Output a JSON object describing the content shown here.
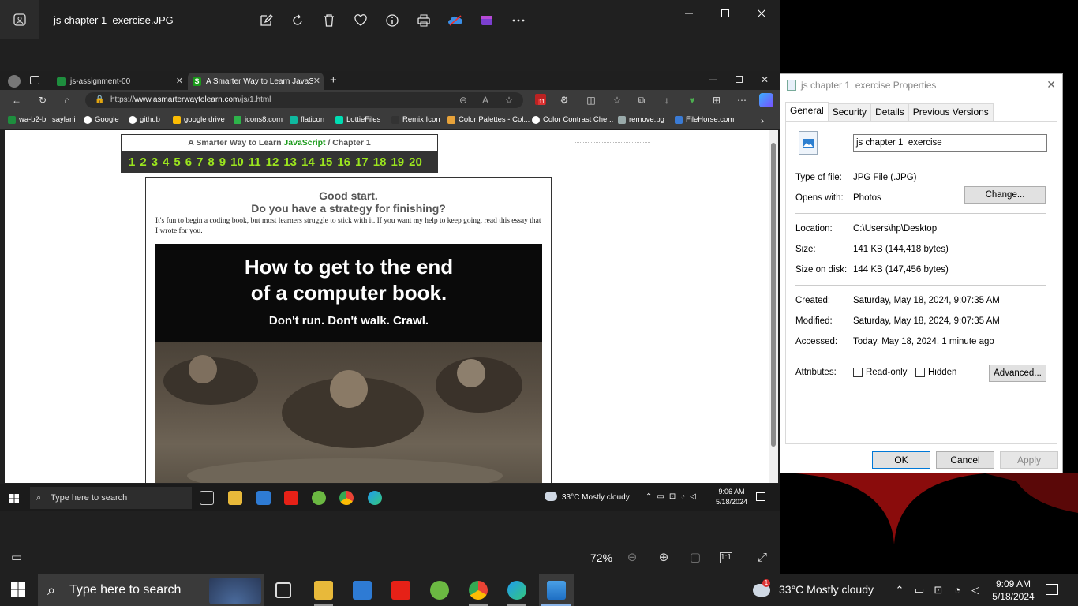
{
  "photos": {
    "title": "js chapter 1  exercise.JPG",
    "toolbar_icons": [
      "edit-icon",
      "rotate-icon",
      "delete-icon",
      "favorite-icon",
      "info-icon",
      "print-icon",
      "onedrive-icon",
      "clipchamp-icon",
      "more-icon"
    ],
    "zoom": "72%"
  },
  "browser": {
    "tabs": [
      {
        "label": "js-assignment-00"
      },
      {
        "label": "A Smarter Way to Learn JavaScript"
      }
    ],
    "url_prefix": "https://",
    "url_host": "www.asmarterwaytolearn.com",
    "url_path": "/js/1.html",
    "favorites": [
      "wa-b2-b",
      "saylani",
      "Google",
      "github",
      "google drive",
      "icons8.com",
      "flaticon",
      "LottieFiles",
      "Remix Icon",
      "Color Palettes - Col...",
      "Color Contrast Che...",
      "remove.bg",
      "FileHorse.com"
    ],
    "ext_badge": "11"
  },
  "webpage": {
    "chapter_title_prefix": "A Smarter Way to Learn ",
    "chapter_title_js": "JavaScript",
    "chapter_title_suffix": "  /  Chapter 1",
    "chapters": [
      "1",
      "2",
      "3",
      "4",
      "5",
      "6",
      "7",
      "8",
      "9",
      "10",
      "11",
      "12",
      "13",
      "14",
      "15",
      "16",
      "17",
      "18",
      "19",
      "20"
    ],
    "heading1": "Good start.",
    "heading2": "Do you have a strategy for finishing?",
    "paragraph": "It's fun to begin a coding book, but most learners struggle to stick with it. If you want my help to keep going, read this essay that I wrote for you.",
    "banner_line1": "How to get to the end",
    "banner_line2": "of a computer book.",
    "banner_line3": "Don't run. Don't walk. Crawl."
  },
  "shot_taskbar": {
    "search": "Type here to search",
    "weather": "33°C  Mostly cloudy",
    "time": "9:06 AM",
    "date": "5/18/2024"
  },
  "properties": {
    "title": "js chapter 1  exercise Properties",
    "tabs": [
      "General",
      "Security",
      "Details",
      "Previous Versions"
    ],
    "filename": "js chapter 1  exercise",
    "type_label": "Type of file:",
    "type_value": "JPG File (.JPG)",
    "opens_label": "Opens with:",
    "opens_value": "Photos",
    "change_label": "Change...",
    "location_label": "Location:",
    "location_value": "C:\\Users\\hp\\Desktop",
    "size_label": "Size:",
    "size_value": "141 KB (144,418 bytes)",
    "disk_label": "Size on disk:",
    "disk_value": "144 KB (147,456 bytes)",
    "created_label": "Created:",
    "created_value": "Saturday, May 18, 2024, 9:07:35 AM",
    "modified_label": "Modified:",
    "modified_value": "Saturday, May 18, 2024, 9:07:35 AM",
    "accessed_label": "Accessed:",
    "accessed_value": "Today, May 18, 2024, 1 minute ago",
    "attributes_label": "Attributes:",
    "readonly_label": "Read-only",
    "hidden_label": "Hidden",
    "advanced_label": "Advanced...",
    "ok_label": "OK",
    "cancel_label": "Cancel",
    "apply_label": "Apply"
  },
  "taskbar": {
    "search": "Type here to search",
    "weather": "33°C  Mostly cloudy",
    "weather_badge": "1",
    "time": "9:09 AM",
    "date": "5/18/2024"
  }
}
